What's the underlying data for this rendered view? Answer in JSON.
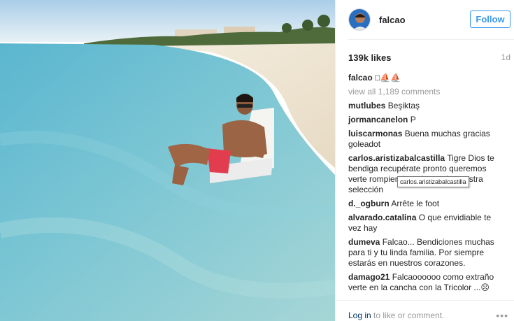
{
  "post": {
    "username": "falcao",
    "follow_label": "Follow",
    "likes": "139k likes",
    "age": "1d"
  },
  "caption": {
    "author": "falcao",
    "text": "□⛵⛵"
  },
  "view_all": "view all 1,189 comments",
  "comments": [
    {
      "author": "mutlubes",
      "text": "Beşiktaş"
    },
    {
      "author": "jormancanelon",
      "text": "P"
    },
    {
      "author": "luiscarmonas",
      "text": "Buena muchas gracias goleadot"
    },
    {
      "author": "carlos.aristizabalcastilla",
      "text": "Tigre Dios te bendiga recupérate pronto queremos verte rompiendo redes en la nuestra selección"
    },
    {
      "author": "d._ogburn",
      "text": "Arrête le foot"
    },
    {
      "author": "alvarado.catalina",
      "text": "O que envidiable te vez hay"
    },
    {
      "author": "dumeva",
      "text": "Falcao... Bendiciones muchas para ti y tu linda familia. Por siempre estarás en nuestros corazones."
    },
    {
      "author": "damago21",
      "text": "Falcaoooooo como extraño verte en la cancha con la Tricolor ...☹"
    }
  ],
  "tooltip": "carlos.aristizabalcastilla",
  "footer": {
    "login": "Log in",
    "rest": " to like or comment."
  },
  "colors": {
    "link_blue": "#3897f0",
    "muted": "#999999",
    "text": "#262626"
  },
  "icons": {
    "more": "more-options-icon"
  }
}
